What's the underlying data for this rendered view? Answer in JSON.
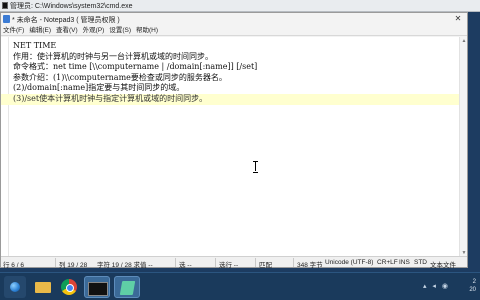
{
  "cmd_window": {
    "title": "管理员: C:\\Windows\\system32\\cmd.exe"
  },
  "notepad": {
    "title": "* 未命名 - Notepad3 ( 管理员权限 )",
    "close_glyph": "✕",
    "menu": [
      "文件(F)",
      "编辑(E)",
      "查看(V)",
      "外观(P)",
      "设置(S)",
      "帮助(H)"
    ],
    "lines": [
      "NET TIME",
      "作用：使计算机的时钟与另一台计算机或域的时间同步。",
      "命令格式：net time [\\\\computername | /domain[:name]] [/set]",
      "参数介绍：(1)\\\\computername要检查或同步的服务器名。",
      "(2)/domain[:name]指定要与其时间同步的域。",
      "(3)/set使本计算机时钟与指定计算机或域的时间同步。"
    ],
    "status": {
      "line_count": "行 6 / 6",
      "column": "列  19 / 28",
      "chars": "字符  19 / 28 求值  --",
      "select": "选  --",
      "sel_lines": "选行  --",
      "bookmark": "匹配",
      "size": "348 字节",
      "encoding": "Unicode (UTF-8)",
      "eol": "CR+LF",
      "ins": "INS",
      "std": "STD",
      "doc_type": "文本文件"
    }
  },
  "taskbar": {
    "tray_time": "2",
    "tray_date": "20"
  },
  "colors": {
    "taskbar": "#1a3a5c",
    "current_line": "#ffffcf",
    "desktop": "#1d3c61"
  }
}
